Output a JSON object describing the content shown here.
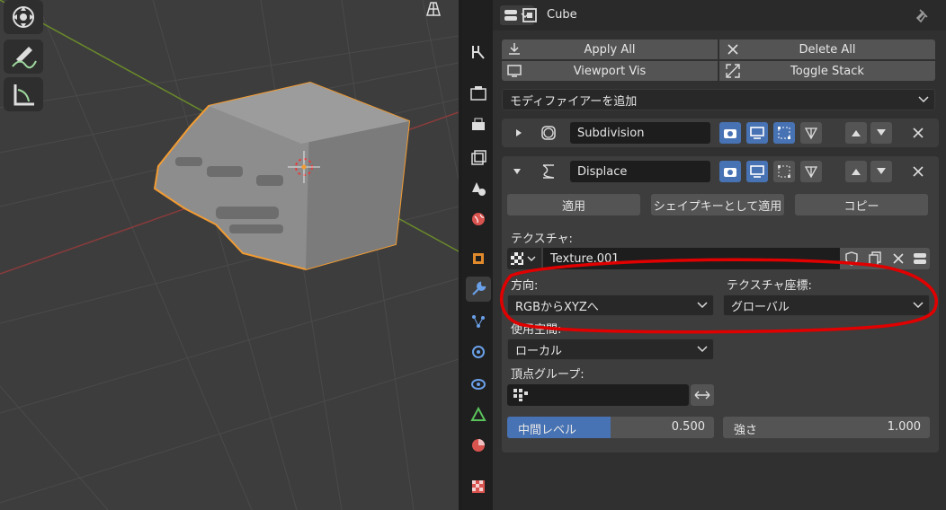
{
  "object": {
    "name": "Cube"
  },
  "toolbar": {
    "apply_all": "Apply All",
    "delete_all": "Delete All",
    "viewport_vis": "Viewport Vis",
    "toggle_stack": "Toggle Stack"
  },
  "add_modifier": "モディファイアーを追加",
  "modifiers": [
    {
      "name": "Subdivision",
      "expanded": false
    },
    {
      "name": "Displace",
      "expanded": true
    }
  ],
  "displace": {
    "apply": "適用",
    "apply_shape_key": "シェイプキーとして適用",
    "copy": "コピー",
    "texture_label": "テクスチャ:",
    "texture_value": "Texture.001",
    "direction_label": "方向:",
    "direction_value": "RGBからXYZへ",
    "tex_coords_label": "テクスチャ座標:",
    "tex_coords_value": "グローバル",
    "space_label": "使用空間:",
    "space_value": "ローカル",
    "vertex_group_label": "頂点グループ:",
    "vertex_group_value": "",
    "midlevel_label": "中間レベル",
    "midlevel_value": "0.500",
    "midlevel_fraction": 0.5,
    "strength_label": "強さ",
    "strength_value": "1.000"
  },
  "colors": {
    "accent": "#4772b3",
    "selection_outline": "#f39c32",
    "annotation": "#e00000"
  }
}
